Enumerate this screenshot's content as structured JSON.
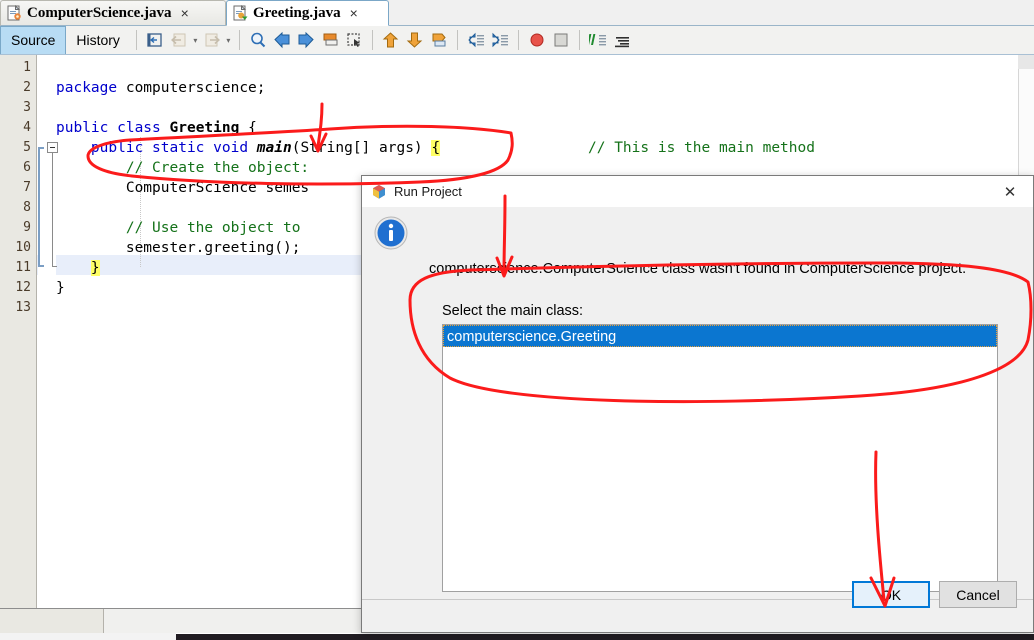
{
  "window": {
    "app": "NetBeans IDE Java Editor"
  },
  "editor_tabs": [
    {
      "label": "ComputerScience.java",
      "icon": "java-file-icon",
      "close": "×",
      "active": false
    },
    {
      "label": "Greeting.java",
      "icon": "java-main-file-icon",
      "close": "×",
      "active": true
    }
  ],
  "view_tabs": [
    {
      "label": "Source",
      "selected": true
    },
    {
      "label": "History",
      "selected": false
    }
  ],
  "toolbar": {
    "icons": [
      "last-edit-icon",
      "back-icon",
      "forward-icon",
      "find-selection-icon",
      "previous-bookmark-icon",
      "next-bookmark-icon",
      "toggle-bookmark-icon",
      "toggle-rectangular-selection-icon",
      "previous-error-icon",
      "next-error-icon",
      "shift-line-right-icon",
      "shift-line-left-icon",
      "comment-icon",
      "uncomment-icon",
      "toggle-breakpoint-icon",
      "stop-icon",
      "diff-icon",
      "inspect-icon"
    ]
  },
  "code": {
    "line_numbers": [
      "1",
      "2",
      "3",
      "4",
      "5",
      "6",
      "7",
      "8",
      "9",
      "10",
      "11",
      "12",
      "13"
    ],
    "lines": [
      {
        "n": 1,
        "segments": []
      },
      {
        "n": 2,
        "segments": [
          {
            "t": "package ",
            "c": "kw"
          },
          {
            "t": "computerscience;",
            "c": "pl"
          }
        ]
      },
      {
        "n": 3,
        "segments": []
      },
      {
        "n": 4,
        "segments": [
          {
            "t": "public class ",
            "c": "kw"
          },
          {
            "t": "Greeting",
            "c": "clsid"
          },
          {
            "t": " {",
            "c": "pl"
          }
        ]
      },
      {
        "n": 5,
        "segments": [
          {
            "t": "    ",
            "c": "pl"
          },
          {
            "t": "public static void ",
            "c": "kw"
          },
          {
            "t": "main",
            "c": "mainid"
          },
          {
            "t": "(String[] args) ",
            "c": "pl"
          },
          {
            "t": "{",
            "c": "brmatch"
          }
        ]
      },
      {
        "n": 6,
        "segments": [
          {
            "t": "        // Create the object:",
            "c": "cm"
          }
        ]
      },
      {
        "n": 7,
        "segments": [
          {
            "t": "        ComputerScience semes",
            "c": "pl"
          }
        ]
      },
      {
        "n": 8,
        "segments": []
      },
      {
        "n": 9,
        "segments": [
          {
            "t": "        // Use the object to",
            "c": "cm"
          }
        ]
      },
      {
        "n": 10,
        "segments": [
          {
            "t": "        semester.greeting();",
            "c": "pl"
          }
        ]
      },
      {
        "n": 11,
        "segments": [
          {
            "t": "    ",
            "c": "pl"
          },
          {
            "t": "}",
            "c": "brmatch"
          }
        ]
      },
      {
        "n": 12,
        "segments": [
          {
            "t": "}",
            "c": "pl"
          }
        ]
      },
      {
        "n": 13,
        "segments": []
      }
    ],
    "trailing_comment": "// This is the main method",
    "highlighted_line": 11
  },
  "dialog": {
    "title": "Run Project",
    "title_icon": "netbeans-cube-icon",
    "close_label": "✕",
    "info_icon": "info-icon",
    "message": "computerscience.ComputerScience class wasn't found in ComputerScience project.",
    "list_label": "Select the main class:",
    "list_items": [
      {
        "label": "computerscience.Greeting",
        "selected": true
      }
    ],
    "buttons": [
      {
        "name": "ok",
        "label": "OK",
        "default": true
      },
      {
        "name": "cancel",
        "label": "Cancel",
        "default": false
      }
    ]
  },
  "annotations": {
    "color": "#fb1b1b",
    "marks": [
      {
        "name": "arrow-to-main",
        "kind": "arrow"
      },
      {
        "name": "ellipse-around-main-signature",
        "kind": "ellipse"
      },
      {
        "name": "arrow-to-select-main-class",
        "kind": "arrow"
      },
      {
        "name": "ellipse-around-class-list",
        "kind": "ellipse"
      },
      {
        "name": "arrow-to-ok-button",
        "kind": "arrow"
      }
    ]
  },
  "colors": {
    "accent_selection": "#0b76d0",
    "annotation_red": "#fb1b1b",
    "keyword_blue": "#0000cc",
    "comment_green": "#15721a",
    "bracket_highlight": "#ffff66",
    "tab_selected_blue": "#b8dcf4"
  }
}
